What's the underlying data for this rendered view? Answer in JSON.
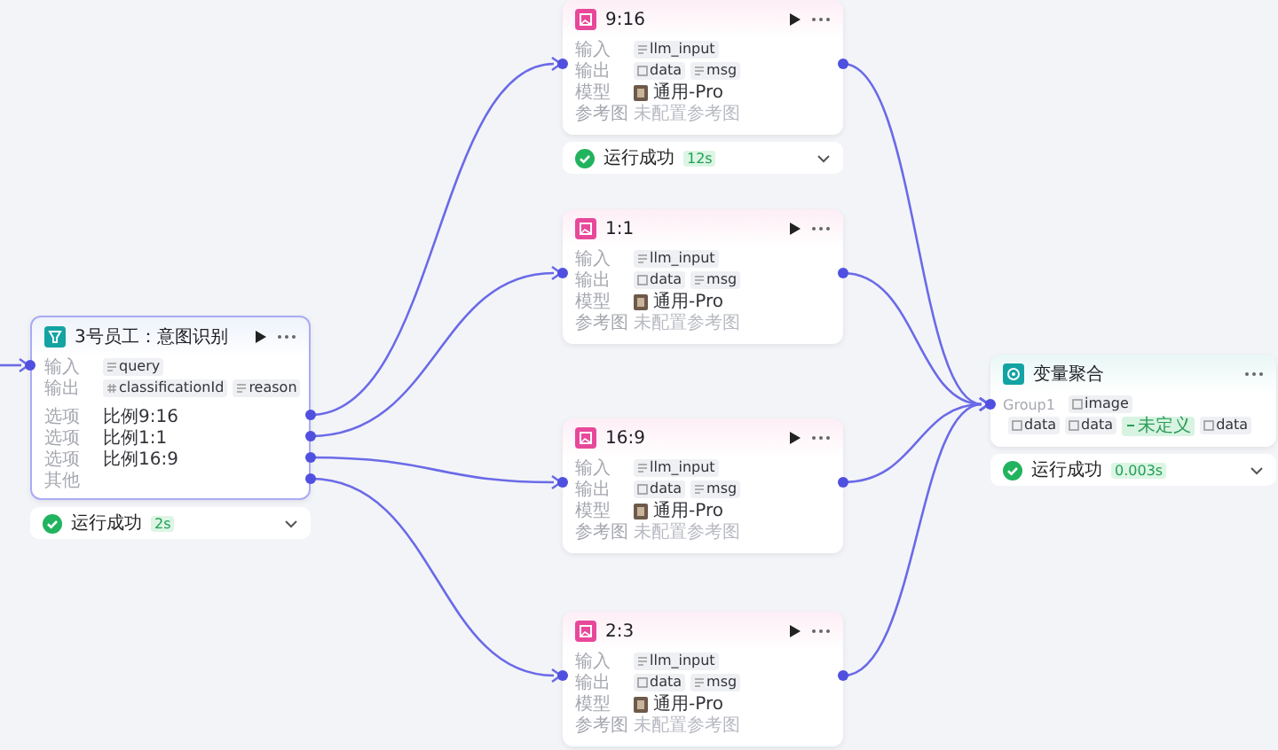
{
  "nodes": [
    {
      "kind": "classifier",
      "title": "3号员工：意图识别",
      "rows": [
        {
          "kind": "tags",
          "label": "输入",
          "tags": [
            {
              "text": "query",
              "kind": "text"
            }
          ]
        },
        {
          "kind": "tags",
          "label": "输出",
          "tags": [
            {
              "text": "classificationId",
              "kind": "number"
            },
            {
              "text": "reason",
              "kind": "text"
            }
          ]
        }
      ],
      "options": [
        {
          "label": "选项",
          "text": "比例9:16"
        },
        {
          "label": "选项",
          "text": "比例1:1"
        },
        {
          "label": "选项",
          "text": "比例16:9"
        },
        {
          "label": "其他"
        }
      ],
      "status": {
        "text": "运行成功",
        "time": "2s"
      }
    },
    {
      "kind": "image",
      "title": "9:16",
      "rows": [
        {
          "kind": "tags",
          "label": "输入",
          "tags": [
            {
              "text": "llm_input",
              "kind": "text"
            }
          ]
        },
        {
          "kind": "tags",
          "label": "输出",
          "tags": [
            {
              "text": "data",
              "kind": "image"
            },
            {
              "text": "msg",
              "kind": "text"
            }
          ]
        },
        {
          "kind": "model",
          "label": "模型",
          "text": "通用-Pro"
        },
        {
          "kind": "hint",
          "label": "参考图",
          "text": "未配置参考图"
        }
      ],
      "status": {
        "text": "运行成功",
        "time": "12s"
      }
    },
    {
      "kind": "image",
      "title": "1:1",
      "rows": [
        {
          "kind": "tags",
          "label": "输入",
          "tags": [
            {
              "text": "llm_input",
              "kind": "text"
            }
          ]
        },
        {
          "kind": "tags",
          "label": "输出",
          "tags": [
            {
              "text": "data",
              "kind": "image"
            },
            {
              "text": "msg",
              "kind": "text"
            }
          ]
        },
        {
          "kind": "model",
          "label": "模型",
          "text": "通用-Pro"
        },
        {
          "kind": "hint",
          "label": "参考图",
          "text": "未配置参考图"
        }
      ]
    },
    {
      "kind": "image",
      "title": "16:9",
      "rows": [
        {
          "kind": "tags",
          "label": "输入",
          "tags": [
            {
              "text": "llm_input",
              "kind": "text"
            }
          ]
        },
        {
          "kind": "tags",
          "label": "输出",
          "tags": [
            {
              "text": "data",
              "kind": "image"
            },
            {
              "text": "msg",
              "kind": "text"
            }
          ]
        },
        {
          "kind": "model",
          "label": "模型",
          "text": "通用-Pro"
        },
        {
          "kind": "hint",
          "label": "参考图",
          "text": "未配置参考图"
        }
      ]
    },
    {
      "kind": "image",
      "title": "2:3",
      "rows": [
        {
          "kind": "tags",
          "label": "输入",
          "tags": [
            {
              "text": "llm_input",
              "kind": "text"
            }
          ]
        },
        {
          "kind": "tags",
          "label": "输出",
          "tags": [
            {
              "text": "data",
              "kind": "image"
            },
            {
              "text": "msg",
              "kind": "text"
            }
          ]
        },
        {
          "kind": "model",
          "label": "模型",
          "text": "通用-Pro"
        },
        {
          "kind": "hint",
          "label": "参考图",
          "text": "未配置参考图"
        }
      ]
    },
    {
      "kind": "aggregator",
      "title": "变量聚合",
      "rows": [
        {
          "kind": "tags",
          "label": "Group1",
          "tags": [
            {
              "text": "image",
              "kind": "image"
            }
          ]
        },
        {
          "kind": "tags",
          "tags": [
            {
              "text": "data",
              "kind": "image"
            },
            {
              "text": "data",
              "kind": "image"
            },
            {
              "text": "未定义",
              "kind": "undefined"
            },
            {
              "text": "data",
              "kind": "image"
            }
          ]
        }
      ],
      "status": {
        "text": "运行成功",
        "time": "0.003s"
      }
    }
  ]
}
